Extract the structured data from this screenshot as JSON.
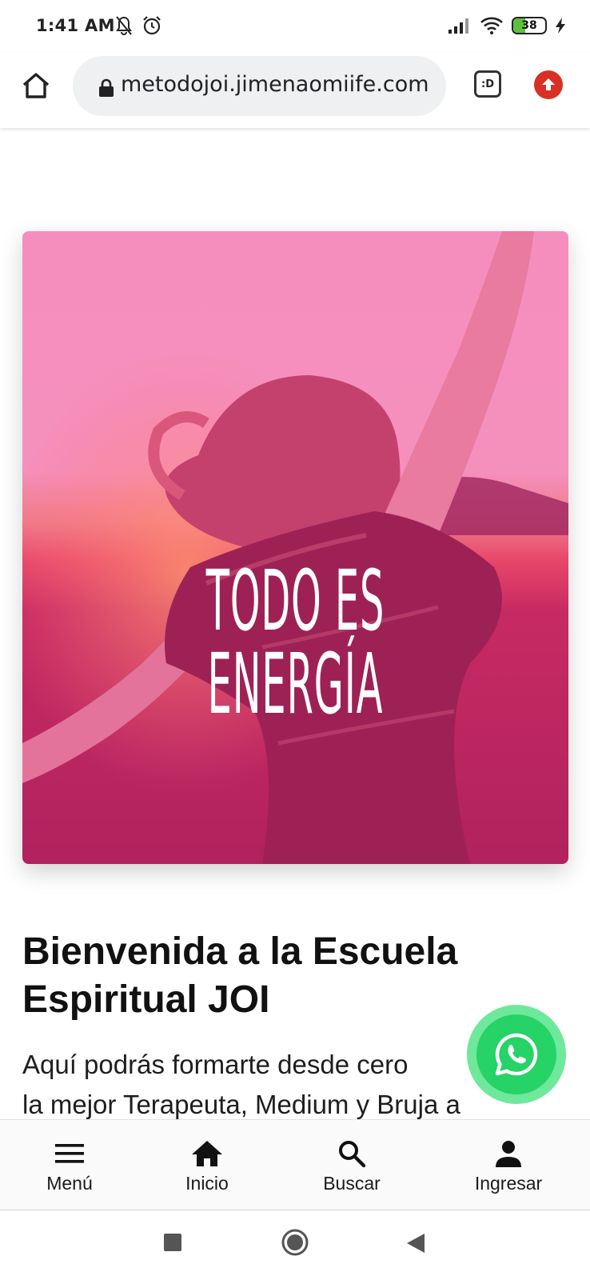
{
  "status_bar": {
    "time": "1:41 AM",
    "battery": "38",
    "battery_level": 0.38,
    "icons_left": [
      "notifications-muted-icon",
      "alarm-icon"
    ],
    "icons_right": [
      "signal-icon",
      "wifi-icon",
      "battery-icon",
      "charging-icon"
    ]
  },
  "browser": {
    "url": "metodojoi.jimenaomiife.com",
    "tab_switcher": ":D",
    "icons": [
      "home-icon",
      "lock-icon",
      "tab-switcher-icon",
      "update-icon"
    ]
  },
  "hero": {
    "caption": "TODO ES ENERGÍA",
    "overlay_color": "#f48bbb"
  },
  "welcome": {
    "title": "Bienvenida a la Escuela Espiritual JOI",
    "body_line1": "Aquí podrás formarte desde cero",
    "body_line2": "la mejor Terapeuta, Medium y Bruja a"
  },
  "whatsapp": {
    "icon": "whatsapp-icon",
    "color": "#25d366"
  },
  "bottom_nav": {
    "items": [
      {
        "label": "Menú",
        "icon": "menu-icon"
      },
      {
        "label": "Inicio",
        "icon": "home-icon"
      },
      {
        "label": "Buscar",
        "icon": "search-icon"
      },
      {
        "label": "Ingresar",
        "icon": "user-icon"
      }
    ]
  },
  "system_nav": {
    "icons": [
      "recents-icon",
      "home-circle-icon",
      "back-icon"
    ]
  }
}
